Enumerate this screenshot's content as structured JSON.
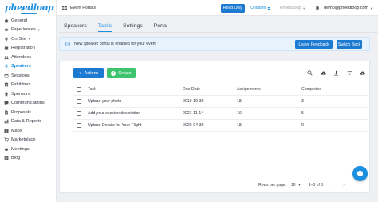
{
  "brand": {
    "logo_text": "pheedloop"
  },
  "sidebar": {
    "items": [
      {
        "label": "General",
        "icon": "home-icon",
        "chevron": ""
      },
      {
        "label": "Experiences",
        "icon": "star-icon",
        "chevron": "▼"
      },
      {
        "label": "On-Site",
        "icon": "pin-icon",
        "chevron": "▼"
      },
      {
        "label": "Registration",
        "icon": "ticket-icon",
        "chevron": ""
      },
      {
        "label": "Attendees",
        "icon": "people-icon",
        "chevron": ""
      },
      {
        "label": "Speakers",
        "icon": "mic-icon",
        "chevron": "",
        "active": true
      },
      {
        "label": "Sessions",
        "icon": "calendar-icon",
        "chevron": ""
      },
      {
        "label": "Exhibitors",
        "icon": "store-icon",
        "chevron": ""
      },
      {
        "label": "Sponsors",
        "icon": "award-icon",
        "chevron": ""
      },
      {
        "label": "Communications",
        "icon": "chat-icon",
        "chevron": ""
      },
      {
        "label": "Proposals",
        "icon": "document-icon",
        "chevron": ""
      },
      {
        "label": "Data & Reports",
        "icon": "chart-icon",
        "chevron": ""
      },
      {
        "label": "Maps",
        "icon": "map-icon",
        "chevron": ""
      },
      {
        "label": "Marketplace",
        "icon": "cart-icon",
        "chevron": ""
      },
      {
        "label": "Meetings",
        "icon": "handshake-icon",
        "chevron": ""
      },
      {
        "label": "Blog",
        "icon": "blog-icon",
        "chevron": ""
      }
    ]
  },
  "topbar": {
    "portal_label": "Event Portals",
    "read_only_label": "Read Only",
    "updates_label": "Updates",
    "event_name": "PheedLoop",
    "user_email": "demo@pheedloop.com"
  },
  "tabs": [
    {
      "label": "Speakers",
      "active": false
    },
    {
      "label": "Tasks",
      "active": true
    },
    {
      "label": "Settings",
      "active": false
    },
    {
      "label": "Portal",
      "active": false
    }
  ],
  "banner": {
    "message": "New speaker portal is enabled for your event",
    "leave_feedback_label": "Leave Feedback",
    "switch_back_label": "Switch Back"
  },
  "toolbar": {
    "actions_label": "Actions",
    "create_label": "Create"
  },
  "table": {
    "columns": [
      "Task",
      "Due Date",
      "Assignments",
      "Completed"
    ],
    "rows": [
      {
        "task": "Upload your photo",
        "due": "2019-10-30",
        "assignments": "18",
        "completed": "3"
      },
      {
        "task": "Add your session description",
        "due": "2021-11-14",
        "assignments": "10",
        "completed": "5"
      },
      {
        "task": "Upload Details for Your Flight",
        "due": "2020-04-30",
        "assignments": "18",
        "completed": "0"
      }
    ]
  },
  "pagination": {
    "rows_per_page_label": "Rows per page:",
    "rows_per_page_value": "10",
    "range_label": "1–3 of 3"
  },
  "colors": {
    "primary": "#1d7ad1",
    "accent": "#1d8fe0",
    "create": "#3ec46d",
    "banner_bg": "#e8f3fd"
  }
}
